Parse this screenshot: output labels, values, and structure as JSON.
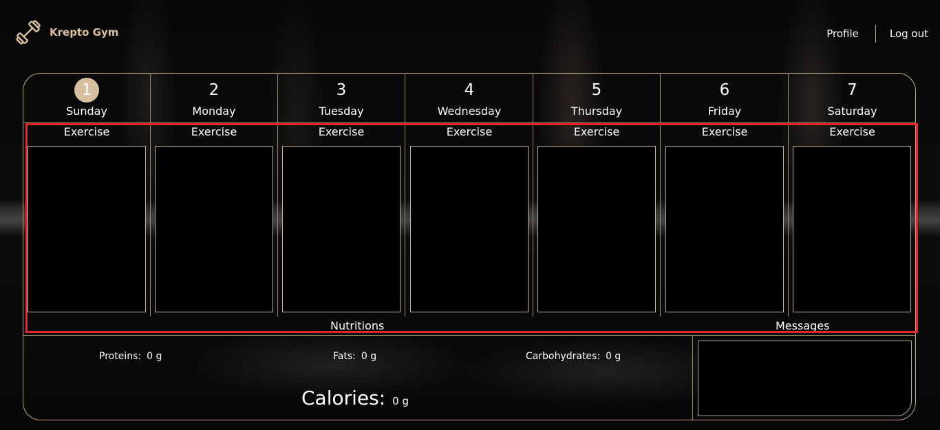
{
  "brand": {
    "name": "Krepto Gym",
    "accent_color": "#d9bf9f",
    "icon": "dumbbell-icon"
  },
  "nav": {
    "profile_label": "Profile",
    "logout_label": "Log out"
  },
  "days": [
    {
      "number": "1",
      "name": "Sunday",
      "exercise_label": "Exercise"
    },
    {
      "number": "2",
      "name": "Monday",
      "exercise_label": "Exercise"
    },
    {
      "number": "3",
      "name": "Tuesday",
      "exercise_label": "Exercise"
    },
    {
      "number": "4",
      "name": "Wednesday",
      "exercise_label": "Exercise"
    },
    {
      "number": "5",
      "name": "Thursday",
      "exercise_label": "Exercise"
    },
    {
      "number": "6",
      "name": "Friday",
      "exercise_label": "Exercise"
    },
    {
      "number": "7",
      "name": "Saturday",
      "exercise_label": "Exercise"
    }
  ],
  "selected_day": "1",
  "nutritions": {
    "title": "Nutritions",
    "proteins_label": "Proteins:",
    "proteins_value": "0 g",
    "fats_label": "Fats:",
    "fats_value": "0 g",
    "carbs_label": "Carbohydrates:",
    "carbs_value": "0 g",
    "calories_label": "Calories:",
    "calories_value": "0 g"
  },
  "messages": {
    "title": "Messages"
  },
  "highlight_color": "#e3262b"
}
